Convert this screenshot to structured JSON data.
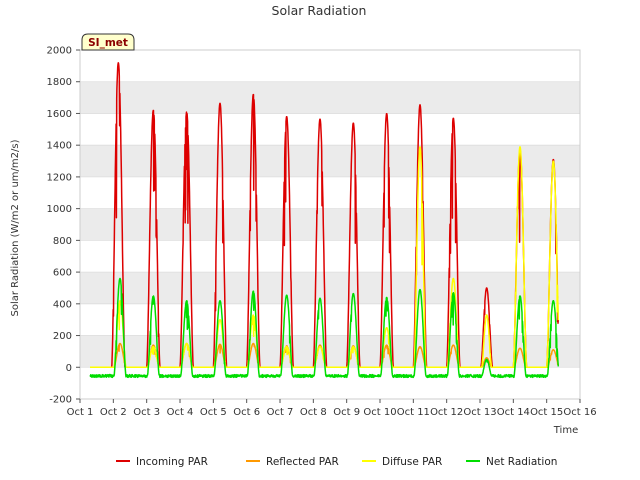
{
  "chart_data": {
    "type": "line",
    "title": "Solar Radiation",
    "xlabel": "Time",
    "ylabel": "Solar Radiation (W/m2 or um/m2/s)",
    "badge": "SI_met",
    "xlim": [
      1,
      16
    ],
    "ylim": [
      -200,
      2000
    ],
    "x_ticks": [
      {
        "value": 1,
        "label": "Oct 1"
      },
      {
        "value": 2,
        "label": "Oct 2"
      },
      {
        "value": 3,
        "label": "Oct 3"
      },
      {
        "value": 4,
        "label": "Oct 4"
      },
      {
        "value": 5,
        "label": "Oct 5"
      },
      {
        "value": 6,
        "label": "Oct 6"
      },
      {
        "value": 7,
        "label": "Oct 7"
      },
      {
        "value": 8,
        "label": "Oct 8"
      },
      {
        "value": 9,
        "label": "Oct 9"
      },
      {
        "value": 10,
        "label": "Oct 10"
      },
      {
        "value": 11,
        "label": "Oct 11"
      },
      {
        "value": 12,
        "label": "Oct 12"
      },
      {
        "value": 13,
        "label": "Oct 13"
      },
      {
        "value": 14,
        "label": "Oct 14"
      },
      {
        "value": 15,
        "label": "Oct 15"
      },
      {
        "value": 16,
        "label": "Oct 16"
      }
    ],
    "y_ticks": [
      -200,
      0,
      200,
      400,
      600,
      800,
      1000,
      1200,
      1400,
      1600,
      1800,
      2000
    ],
    "grid": "horizontal bands",
    "legend_position": "bottom",
    "series": [
      {
        "name": "Incoming PAR",
        "color": "#dd0000",
        "days": [
          {
            "center": 2.15,
            "peak": 1920,
            "width": 0.4
          },
          {
            "center": 3.2,
            "peak": 1620,
            "width": 0.4
          },
          {
            "center": 4.2,
            "peak": 1610,
            "width": 0.4
          },
          {
            "center": 5.2,
            "peak": 1665,
            "width": 0.4
          },
          {
            "center": 6.2,
            "peak": 1720,
            "width": 0.4
          },
          {
            "center": 7.2,
            "peak": 1580,
            "width": 0.4
          },
          {
            "center": 8.2,
            "peak": 1565,
            "width": 0.4
          },
          {
            "center": 9.2,
            "peak": 1540,
            "width": 0.4
          },
          {
            "center": 10.2,
            "peak": 1600,
            "width": 0.4
          },
          {
            "center": 11.2,
            "peak": 1655,
            "width": 0.4
          },
          {
            "center": 12.2,
            "peak": 1570,
            "width": 0.4
          },
          {
            "center": 13.2,
            "peak": 500,
            "width": 0.35
          },
          {
            "center": 14.2,
            "peak": 1370,
            "width": 0.4
          },
          {
            "center": 15.2,
            "peak": 1310,
            "width": 0.4
          }
        ],
        "night": 0
      },
      {
        "name": "Reflected PAR",
        "color": "#ff9900",
        "days": [
          {
            "center": 2.2,
            "peak": 150,
            "width": 0.36
          },
          {
            "center": 3.2,
            "peak": 140,
            "width": 0.36
          },
          {
            "center": 4.2,
            "peak": 150,
            "width": 0.36
          },
          {
            "center": 5.2,
            "peak": 145,
            "width": 0.36
          },
          {
            "center": 6.2,
            "peak": 150,
            "width": 0.36
          },
          {
            "center": 7.2,
            "peak": 135,
            "width": 0.36
          },
          {
            "center": 8.2,
            "peak": 140,
            "width": 0.36
          },
          {
            "center": 9.2,
            "peak": 135,
            "width": 0.36
          },
          {
            "center": 10.2,
            "peak": 140,
            "width": 0.36
          },
          {
            "center": 11.2,
            "peak": 130,
            "width": 0.36
          },
          {
            "center": 12.2,
            "peak": 140,
            "width": 0.36
          },
          {
            "center": 13.2,
            "peak": 60,
            "width": 0.3
          },
          {
            "center": 14.2,
            "peak": 120,
            "width": 0.36
          },
          {
            "center": 15.2,
            "peak": 110,
            "width": 0.36
          }
        ],
        "night": 0
      },
      {
        "name": "Diffuse PAR",
        "color": "#ffff00",
        "days": [
          {
            "center": 2.2,
            "peak": 420,
            "width": 0.36
          },
          {
            "center": 3.2,
            "peak": 130,
            "width": 0.36
          },
          {
            "center": 4.2,
            "peak": 150,
            "width": 0.36
          },
          {
            "center": 5.2,
            "peak": 300,
            "width": 0.36
          },
          {
            "center": 6.2,
            "peak": 330,
            "width": 0.36
          },
          {
            "center": 7.2,
            "peak": 130,
            "width": 0.36
          },
          {
            "center": 8.2,
            "peak": 130,
            "width": 0.36
          },
          {
            "center": 9.2,
            "peak": 130,
            "width": 0.36
          },
          {
            "center": 10.2,
            "peak": 250,
            "width": 0.36
          },
          {
            "center": 11.2,
            "peak": 1390,
            "width": 0.36
          },
          {
            "center": 12.2,
            "peak": 560,
            "width": 0.36
          },
          {
            "center": 13.2,
            "peak": 330,
            "width": 0.3
          },
          {
            "center": 14.2,
            "peak": 1390,
            "width": 0.4
          },
          {
            "center": 15.2,
            "peak": 1300,
            "width": 0.4
          }
        ],
        "night": 0
      },
      {
        "name": "Net Radiation",
        "color": "#00dd00",
        "days": [
          {
            "center": 2.2,
            "peak": 560,
            "width": 0.36
          },
          {
            "center": 3.2,
            "peak": 450,
            "width": 0.36
          },
          {
            "center": 4.2,
            "peak": 420,
            "width": 0.36
          },
          {
            "center": 5.2,
            "peak": 420,
            "width": 0.36
          },
          {
            "center": 6.2,
            "peak": 480,
            "width": 0.36
          },
          {
            "center": 7.2,
            "peak": 455,
            "width": 0.36
          },
          {
            "center": 8.2,
            "peak": 435,
            "width": 0.36
          },
          {
            "center": 9.2,
            "peak": 465,
            "width": 0.36
          },
          {
            "center": 10.2,
            "peak": 440,
            "width": 0.36
          },
          {
            "center": 11.2,
            "peak": 490,
            "width": 0.36
          },
          {
            "center": 12.2,
            "peak": 470,
            "width": 0.36
          },
          {
            "center": 13.2,
            "peak": 50,
            "width": 0.3
          },
          {
            "center": 14.2,
            "peak": 450,
            "width": 0.36
          },
          {
            "center": 15.2,
            "peak": 420,
            "width": 0.36
          }
        ],
        "night": -55
      }
    ]
  }
}
